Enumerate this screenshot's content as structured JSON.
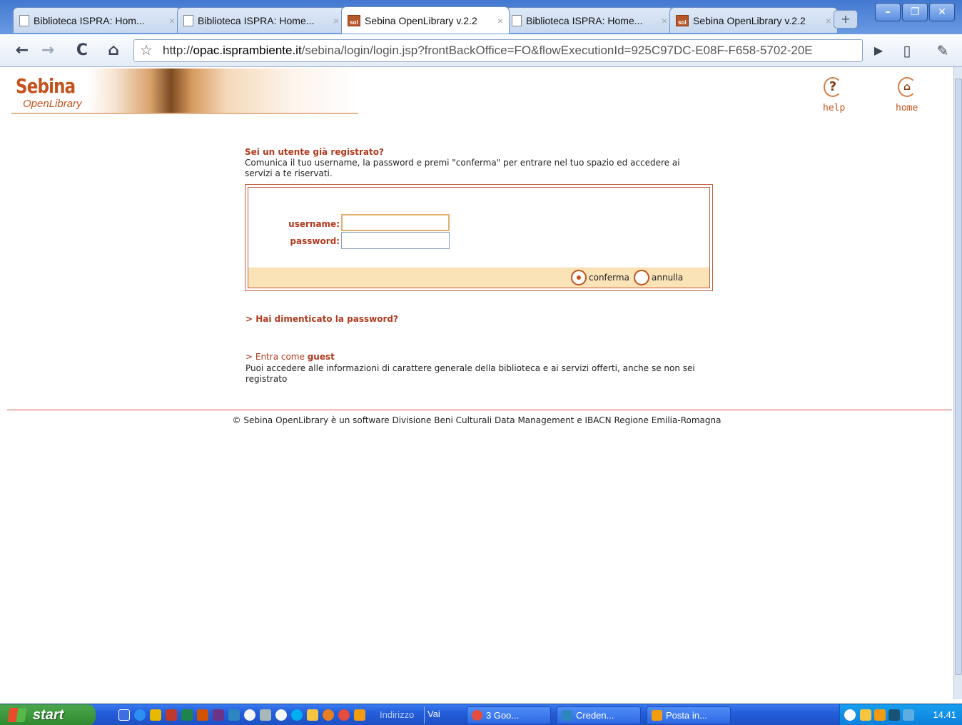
{
  "browser": {
    "tabs": [
      {
        "title": "Biblioteca ISPRA: Hom...",
        "favicon": "page-icon",
        "active": false
      },
      {
        "title": "Biblioteca ISPRA: Home...",
        "favicon": "page-icon",
        "active": false
      },
      {
        "title": "Sebina OpenLibrary v.2.2",
        "favicon": "sebina-icon",
        "active": true
      },
      {
        "title": "Biblioteca ISPRA: Home...",
        "favicon": "page-icon",
        "active": false
      },
      {
        "title": "Sebina OpenLibrary v.2.2",
        "favicon": "sebina-icon",
        "active": false
      }
    ],
    "url_scheme": "http://",
    "url_host": "opac.isprambiente.it",
    "url_rest": "/sebina/login/login.jsp?frontBackOffice=FO&flowExecutionId=925C97DC-E08F-F658-5702-20E"
  },
  "header": {
    "logo_main": "Sebina",
    "logo_sub": "OpenLibrary",
    "help_label": "help",
    "home_label": "home"
  },
  "login": {
    "registered_heading": "Sei un utente già registrato?",
    "registered_text": "Comunica il tuo username, la password e premi \"conferma\" per entrare nel tuo spazio ed accedere ai servizi a te riservati.",
    "username_label": "username:",
    "password_label": "password:",
    "username_value": "",
    "password_value": "",
    "confirm_label": "conferma",
    "cancel_label": "annulla"
  },
  "links": {
    "forgot_password": "> Hai dimenticato la password?",
    "guest_prefix": "> Entra come ",
    "guest_bold": "guest",
    "guest_text": "Puoi accedere alle informazioni di carattere generale della biblioteca e ai servizi offerti, anche se non sei registrato"
  },
  "footer": {
    "text": "© Sebina OpenLibrary è un software  Divisione Beni Culturali Data Management  e  IBACN Regione Emilia-Romagna"
  },
  "taskbar": {
    "start_label": "start",
    "address_label": "Indirizzo",
    "go_label": "Vai",
    "tasks": [
      "3 Goo...",
      "Creden...",
      "Posta in..."
    ],
    "clock": "14.41"
  },
  "colors": {
    "accent": "#c4521c",
    "heading_red": "#b03a1e",
    "action_bar": "#fbe3b8"
  }
}
